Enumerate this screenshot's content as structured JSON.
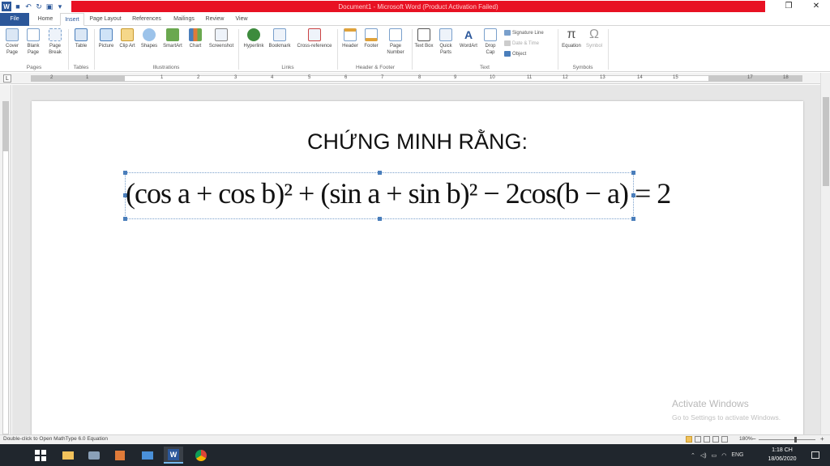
{
  "window": {
    "title": "Document1 - Microsoft Word (Product Activation Failed)",
    "title_bar_color": "#e81123",
    "accent": "#2b579a"
  },
  "tabs": [
    {
      "label": "File"
    },
    {
      "label": "Home"
    },
    {
      "label": "Insert"
    },
    {
      "label": "Page Layout"
    },
    {
      "label": "References"
    },
    {
      "label": "Mailings"
    },
    {
      "label": "Review"
    },
    {
      "label": "View"
    }
  ],
  "ribbon": {
    "pages": {
      "cover": "Cover Page",
      "blank": "Blank Page",
      "break": "Page Break",
      "group": "Pages"
    },
    "tables": {
      "table": "Table",
      "group": "Tables"
    },
    "illustrations": {
      "picture": "Picture",
      "clipart": "Clip Art",
      "shapes": "Shapes",
      "smartart": "SmartArt",
      "chart": "Chart",
      "screenshot": "Screenshot",
      "group": "Illustrations"
    },
    "links": {
      "hyperlink": "Hyperlink",
      "bookmark": "Bookmark",
      "crossref": "Cross-reference",
      "group": "Links"
    },
    "header_footer": {
      "header": "Header",
      "footer": "Footer",
      "pagenum": "Page Number",
      "group": "Header & Footer"
    },
    "text": {
      "textbox": "Text Box",
      "quickparts": "Quick Parts",
      "wordart": "WordArt",
      "dropcap": "Drop Cap",
      "signature": "Signature Line",
      "datetime": "Date & Time",
      "object": "Object",
      "group": "Text"
    },
    "symbols": {
      "equation": "Equation",
      "symbol": "Symbol",
      "group": "Symbols"
    }
  },
  "ruler": {
    "numbers": [
      "2",
      "1",
      "1",
      "2",
      "3",
      "4",
      "5",
      "6",
      "7",
      "8",
      "9",
      "10",
      "11",
      "12",
      "13",
      "14",
      "15",
      "17",
      "18"
    ]
  },
  "document": {
    "heading": "CHỨNG MINH RẰNG:",
    "equation": "(cos a + cos b)² + (sin a + sin b)² − 2cos(b − a) = 2"
  },
  "watermark": {
    "line1": "Activate Windows",
    "line2": "Go to Settings to activate Windows."
  },
  "statusbar": {
    "message": "Double-click to Open MathType 6.0 Equation",
    "zoom": "180%"
  },
  "taskbar": {
    "language": "ENG",
    "time": "1:18 CH",
    "date": "18/06/2020"
  }
}
